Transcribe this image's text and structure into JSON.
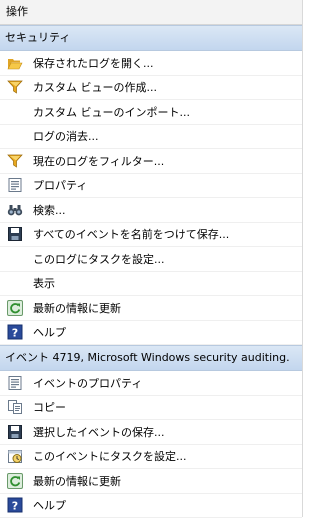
{
  "pane": {
    "title": "操作"
  },
  "sections": [
    {
      "title": "セキュリティ",
      "items": [
        {
          "label": "保存されたログを開く...",
          "icon": "folder-open-icon"
        },
        {
          "label": "カスタム ビューの作成...",
          "icon": "filter-icon"
        },
        {
          "label": "カスタム ビューのインポート...",
          "icon": ""
        },
        {
          "label": "ログの消去...",
          "icon": ""
        },
        {
          "label": "現在のログをフィルター...",
          "icon": "filter-icon"
        },
        {
          "label": "プロパティ",
          "icon": "properties-icon"
        },
        {
          "label": "検索...",
          "icon": "binoculars-icon"
        },
        {
          "label": "すべてのイベントを名前をつけて保存...",
          "icon": "save-icon"
        },
        {
          "label": "このログにタスクを設定...",
          "icon": ""
        },
        {
          "label": "表示",
          "icon": ""
        },
        {
          "label": "最新の情報に更新",
          "icon": "refresh-icon"
        },
        {
          "label": "ヘルプ",
          "icon": "help-icon"
        }
      ]
    },
    {
      "title": "イベント 4719, Microsoft Windows security auditing.",
      "items": [
        {
          "label": "イベントのプロパティ",
          "icon": "properties-icon"
        },
        {
          "label": "コピー",
          "icon": "copy-icon"
        },
        {
          "label": "選択したイベントの保存...",
          "icon": "save-icon"
        },
        {
          "label": "このイベントにタスクを設定...",
          "icon": "task-icon"
        },
        {
          "label": "最新の情報に更新",
          "icon": "refresh-icon"
        },
        {
          "label": "ヘルプ",
          "icon": "help-icon"
        }
      ]
    }
  ]
}
